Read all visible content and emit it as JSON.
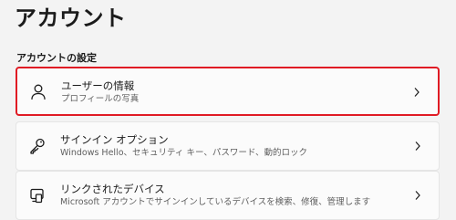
{
  "page": {
    "title": "アカウント"
  },
  "section": {
    "title": "アカウントの設定"
  },
  "items": [
    {
      "icon": "person-icon",
      "title": "ユーザーの情報",
      "subtitle": "プロフィールの写真",
      "selected": true
    },
    {
      "icon": "key-icon",
      "title": "サインイン オプション",
      "subtitle": "Windows Hello、セキュリティ キー、パスワード、動的ロック",
      "selected": false
    },
    {
      "icon": "devices-icon",
      "title": "リンクされたデバイス",
      "subtitle": "Microsoft アカウントでサインインしているデバイスを検索、修復、管理します",
      "selected": false
    }
  ],
  "colors": {
    "highlight_border": "#e01b24",
    "background": "#f3f3f3",
    "card": "#fbfbfb"
  }
}
